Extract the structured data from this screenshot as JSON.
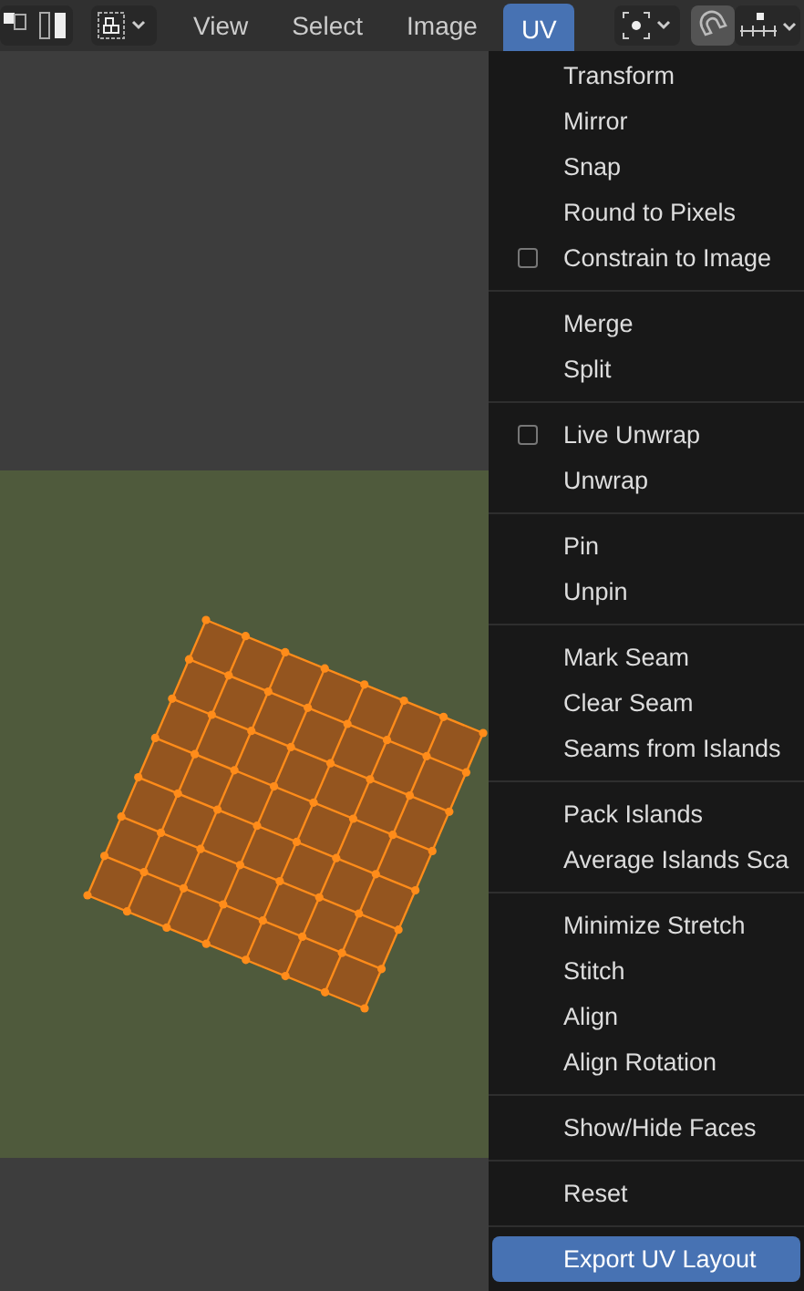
{
  "header": {
    "menus": [
      {
        "label": "View",
        "selected": false
      },
      {
        "label": "Select",
        "selected": false
      },
      {
        "label": "Image",
        "selected": false
      },
      {
        "label": "UV",
        "selected": true
      }
    ]
  },
  "uv_menu": {
    "sections": [
      [
        {
          "label": "Transform",
          "kind": "action",
          "selected": false
        },
        {
          "label": "Mirror",
          "kind": "action",
          "selected": false
        },
        {
          "label": "Snap",
          "kind": "action",
          "selected": false
        },
        {
          "label": "Round to Pixels",
          "kind": "action",
          "selected": false
        },
        {
          "label": "Constrain to Image",
          "kind": "toggle",
          "checked": false,
          "selected": false
        }
      ],
      [
        {
          "label": "Merge",
          "kind": "action",
          "selected": false
        },
        {
          "label": "Split",
          "kind": "action",
          "selected": false
        }
      ],
      [
        {
          "label": "Live Unwrap",
          "kind": "toggle",
          "checked": false,
          "selected": false
        },
        {
          "label": "Unwrap",
          "kind": "action",
          "selected": false
        }
      ],
      [
        {
          "label": "Pin",
          "kind": "action",
          "selected": false
        },
        {
          "label": "Unpin",
          "kind": "action",
          "selected": false
        }
      ],
      [
        {
          "label": "Mark Seam",
          "kind": "action",
          "selected": false
        },
        {
          "label": "Clear Seam",
          "kind": "action",
          "selected": false
        },
        {
          "label": "Seams from Islands",
          "kind": "action",
          "selected": false
        }
      ],
      [
        {
          "label": "Pack Islands",
          "kind": "action",
          "selected": false
        },
        {
          "label": "Average Islands Sca",
          "kind": "action",
          "selected": false
        }
      ],
      [
        {
          "label": "Minimize Stretch",
          "kind": "action",
          "selected": false
        },
        {
          "label": "Stitch",
          "kind": "action",
          "selected": false
        },
        {
          "label": "Align",
          "kind": "action",
          "selected": false
        },
        {
          "label": "Align Rotation",
          "kind": "action",
          "selected": false
        }
      ],
      [
        {
          "label": "Show/Hide Faces",
          "kind": "action",
          "selected": false
        }
      ],
      [
        {
          "label": "Reset",
          "kind": "action",
          "selected": false
        }
      ],
      [
        {
          "label": "Export UV Layout",
          "kind": "action",
          "selected": true
        }
      ]
    ]
  }
}
